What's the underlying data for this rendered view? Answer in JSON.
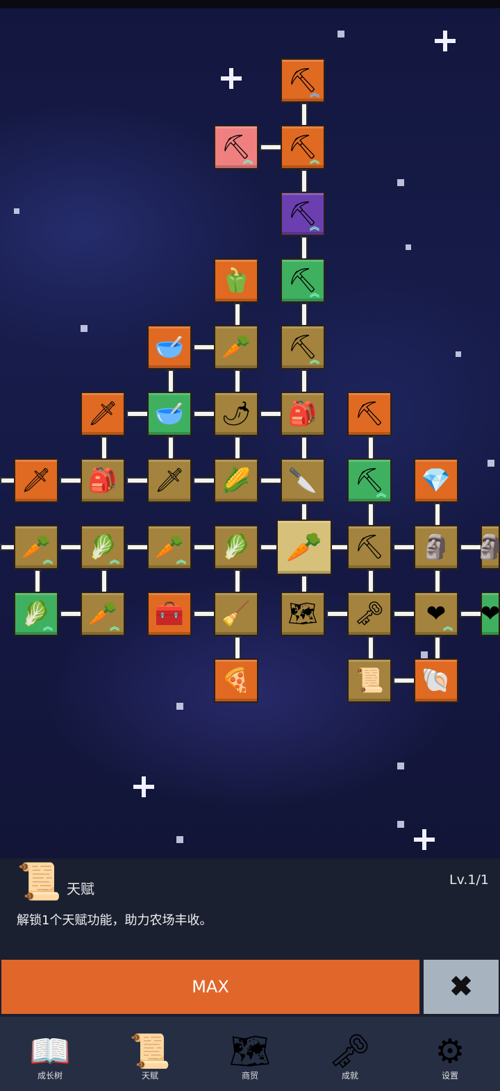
{
  "tree": {
    "nodes": [
      {
        "id": "shovel-top",
        "icon": "shovel",
        "glyph": "⛏",
        "color": "orange",
        "badge": "blue"
      },
      {
        "id": "shovel-pink",
        "icon": "shovel",
        "glyph": "⛏",
        "color": "pink",
        "badge": "green"
      },
      {
        "id": "shovel-2",
        "icon": "shovel",
        "glyph": "⛏",
        "color": "orange",
        "badge": "green"
      },
      {
        "id": "shovel-purple",
        "icon": "shovel",
        "glyph": "⛏",
        "color": "purple",
        "badge": "green"
      },
      {
        "id": "pepper",
        "icon": "bell-pepper",
        "glyph": "🫑",
        "color": "orange",
        "badge": ""
      },
      {
        "id": "shovel-green",
        "icon": "shovel",
        "glyph": "⛏",
        "color": "green",
        "badge": "green"
      },
      {
        "id": "bowl-grain",
        "icon": "bowl",
        "glyph": "🥣",
        "color": "orange",
        "badge": ""
      },
      {
        "id": "radish",
        "icon": "radish",
        "glyph": "🥕",
        "color": "gold",
        "badge": ""
      },
      {
        "id": "shovel-gold",
        "icon": "shovel",
        "glyph": "⛏",
        "color": "gold",
        "badge": "green"
      },
      {
        "id": "sword-gold",
        "icon": "sword",
        "glyph": "🗡",
        "color": "orange",
        "badge": ""
      },
      {
        "id": "bowl-green",
        "icon": "bowl",
        "glyph": "🥣",
        "color": "green",
        "badge": ""
      },
      {
        "id": "chili",
        "icon": "chili",
        "glyph": "🌶",
        "color": "gold",
        "badge": ""
      },
      {
        "id": "backpack",
        "icon": "backpack",
        "glyph": "🎒",
        "color": "gold",
        "badge": ""
      },
      {
        "id": "pickaxe-top",
        "icon": "pickaxe",
        "glyph": "⛏",
        "color": "orange",
        "badge": ""
      },
      {
        "id": "sword-left",
        "icon": "sword",
        "glyph": "🗡",
        "color": "orange",
        "badge": ""
      },
      {
        "id": "backpack-2",
        "icon": "backpack",
        "glyph": "🎒",
        "color": "gold",
        "badge": ""
      },
      {
        "id": "sword-mid",
        "icon": "sword",
        "glyph": "🗡",
        "color": "gold",
        "badge": ""
      },
      {
        "id": "corn",
        "icon": "corn",
        "glyph": "🌽",
        "color": "gold",
        "badge": ""
      },
      {
        "id": "dagger",
        "icon": "dagger",
        "glyph": "🔪",
        "color": "gold",
        "badge": ""
      },
      {
        "id": "pickaxe-green",
        "icon": "pickaxe",
        "glyph": "⛏",
        "color": "green",
        "badge": "green"
      },
      {
        "id": "crystal",
        "icon": "crystal",
        "glyph": "💎",
        "color": "orange",
        "badge": ""
      },
      {
        "id": "carrot-1",
        "icon": "carrot",
        "glyph": "🥕",
        "color": "gold",
        "badge": "green"
      },
      {
        "id": "cabbage-1",
        "icon": "cabbage",
        "glyph": "🥬",
        "color": "gold",
        "badge": "green"
      },
      {
        "id": "carrot-2",
        "icon": "carrot",
        "glyph": "🥕",
        "color": "gold",
        "badge": "green"
      },
      {
        "id": "cabbage-2",
        "icon": "cabbage",
        "glyph": "🥬",
        "color": "gold",
        "badge": ""
      },
      {
        "id": "carrot-big",
        "icon": "carrot",
        "glyph": "🥕",
        "color": "gold",
        "badge": ""
      },
      {
        "id": "pickaxe-gold",
        "icon": "pickaxe",
        "glyph": "⛏",
        "color": "gold",
        "badge": ""
      },
      {
        "id": "statue",
        "icon": "statue",
        "glyph": "🗿",
        "color": "gold",
        "badge": ""
      },
      {
        "id": "statue-edge",
        "icon": "statue",
        "glyph": "🗿",
        "color": "gold",
        "badge": ""
      },
      {
        "id": "cabbage-green",
        "icon": "cabbage",
        "glyph": "🥬",
        "color": "green",
        "badge": "green"
      },
      {
        "id": "carrot-3",
        "icon": "carrot",
        "glyph": "🥕",
        "color": "gold",
        "badge": "green"
      },
      {
        "id": "chest",
        "icon": "treasure-chest",
        "glyph": "🧰",
        "color": "orange",
        "badge": ""
      },
      {
        "id": "broom",
        "icon": "broom",
        "glyph": "🧹",
        "color": "gold",
        "badge": ""
      },
      {
        "id": "map",
        "icon": "map",
        "glyph": "🗺",
        "color": "gold",
        "badge": ""
      },
      {
        "id": "key",
        "icon": "key",
        "glyph": "🗝",
        "color": "gold",
        "badge": ""
      },
      {
        "id": "heart",
        "icon": "heart",
        "glyph": "❤",
        "color": "gold",
        "badge": "green"
      },
      {
        "id": "heart-edge",
        "icon": "heart",
        "glyph": "❤",
        "color": "green",
        "badge": ""
      },
      {
        "id": "pizza",
        "icon": "pizza",
        "glyph": "🍕",
        "color": "orange",
        "badge": ""
      },
      {
        "id": "scroll",
        "icon": "scroll",
        "glyph": "📜",
        "color": "gold",
        "badge": ""
      },
      {
        "id": "fossil",
        "icon": "fossil",
        "glyph": "🐚",
        "color": "orange",
        "badge": ""
      }
    ],
    "selected": "carrot-big"
  },
  "detail": {
    "icon": "scroll-icon",
    "icon_glyph": "📜",
    "title": "天赋",
    "level": "Lv.1/1",
    "description": "解锁1个天赋功能，助力农场丰收。",
    "max_label": "MAX",
    "close_glyph": "✖"
  },
  "tabs": [
    {
      "label": "成长树",
      "icon": "book-icon",
      "glyph": "📖"
    },
    {
      "label": "天赋",
      "icon": "scroll-icon",
      "glyph": "📜"
    },
    {
      "label": "商贸",
      "icon": "map-icon",
      "glyph": "🗺"
    },
    {
      "label": "成就",
      "icon": "key-icon",
      "glyph": "🗝"
    },
    {
      "label": "设置",
      "icon": "gear-icon",
      "glyph": "⚙"
    }
  ],
  "colors": {
    "orange": "#e06a22",
    "gold": "#a3833d",
    "green": "#3fb060",
    "purple": "#6b3fb0",
    "max_button": "#e0662a",
    "close_button": "#a7b3bf",
    "panel": "#1b2030",
    "tabbar": "#262e44"
  }
}
